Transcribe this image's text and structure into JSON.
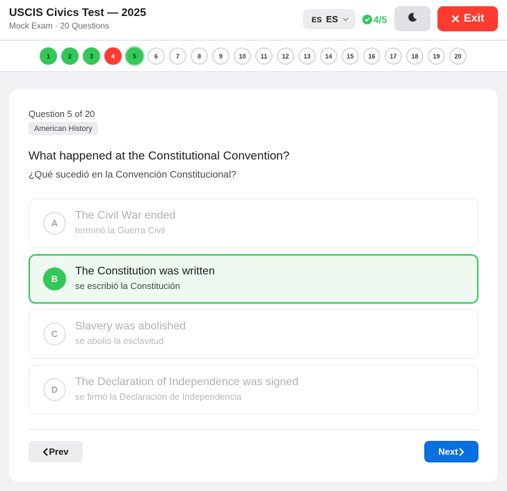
{
  "header": {
    "title": "USCIS Civics Test — 2025",
    "subtitle": "Mock Exam · 20 Questions",
    "language": {
      "flag_code": "ES",
      "label": "ES"
    },
    "score": "4/5",
    "exit_label": "Exit"
  },
  "progress": {
    "questions": [
      {
        "label": "1",
        "status": "correct"
      },
      {
        "label": "2",
        "status": "correct"
      },
      {
        "label": "3",
        "status": "correct"
      },
      {
        "label": "4",
        "status": "wrong"
      },
      {
        "label": "5",
        "status": "current"
      },
      {
        "label": "6",
        "status": "pending"
      },
      {
        "label": "7",
        "status": "pending"
      },
      {
        "label": "8",
        "status": "pending"
      },
      {
        "label": "9",
        "status": "pending"
      },
      {
        "label": "10",
        "status": "pending"
      },
      {
        "label": "11",
        "status": "pending"
      },
      {
        "label": "12",
        "status": "pending"
      },
      {
        "label": "13",
        "status": "pending"
      },
      {
        "label": "14",
        "status": "pending"
      },
      {
        "label": "15",
        "status": "pending"
      },
      {
        "label": "16",
        "status": "pending"
      },
      {
        "label": "17",
        "status": "pending"
      },
      {
        "label": "18",
        "status": "pending"
      },
      {
        "label": "19",
        "status": "pending"
      },
      {
        "label": "20",
        "status": "pending"
      }
    ]
  },
  "question": {
    "counter": "Question 5 of 20",
    "category": "American History",
    "text": "What happened at the Constitutional Convention?",
    "translation": "¿Qué sucedió en la Convención Constitucional?",
    "options": [
      {
        "letter": "A",
        "en": "The Civil War ended",
        "es": "terminó la Guerra Civil",
        "selected": false
      },
      {
        "letter": "B",
        "en": "The Constitution was written",
        "es": "se escribió la Constitución",
        "selected": true
      },
      {
        "letter": "C",
        "en": "Slavery was abolished",
        "es": "se abolió la esclavitud",
        "selected": false
      },
      {
        "letter": "D",
        "en": "The Declaration of Independence was signed",
        "es": "se firmó la Declaración de Independencia",
        "selected": false
      }
    ]
  },
  "nav": {
    "prev_label": "Prev",
    "next_label": "Next"
  },
  "colors": {
    "correct": "#34c759",
    "wrong": "#ff3b30",
    "primary": "#0a6fe0",
    "exit": "#ff3b30"
  },
  "icons": {
    "language": "chevron-down-icon",
    "score": "check-circle-icon",
    "theme": "moon-icon",
    "exit": "close-icon",
    "prev": "chevron-left-icon",
    "next": "chevron-right-icon"
  }
}
